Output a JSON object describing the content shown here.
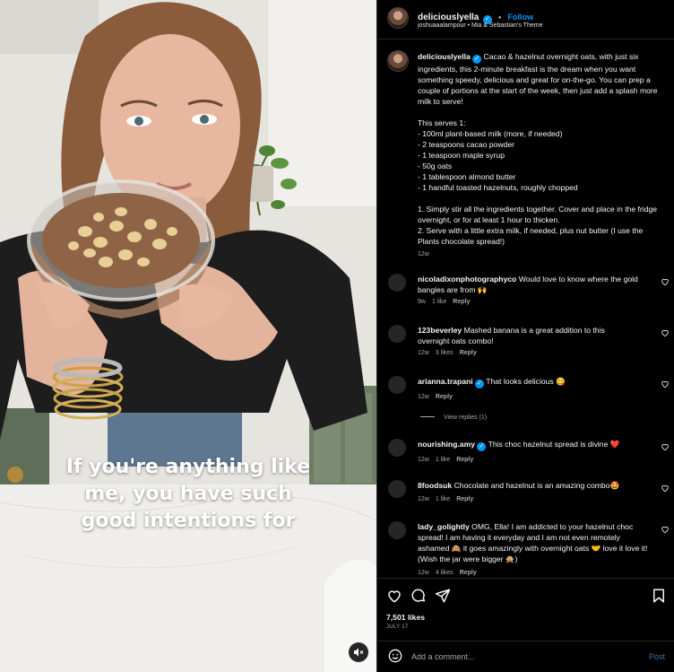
{
  "post": {
    "username": "deliciouslyella",
    "verified_mark": "✓",
    "separator": "•",
    "follow_label": "Follow",
    "audio_line": "joshuaaalampour • Mia & Sebastian's Theme",
    "caption": "Cacao & hazelnut overnight oats, with just six ingredients, this 2-minute breakfast is the dream when you want something speedy, delicious and great for on-the-go. You can prep a couple of portions at the start of the week, then just add a splash more milk to serve!\n\nThis serves 1:\n- 100ml plant-based milk (more, if needed)\n- 2 teaspoons cacao powder\n- 1 teaspoon maple syrup\n- 50g oats\n- 1 tablespoon almond butter\n- 1 handful toasted hazelnuts, roughly chopped\n\n1. Simply stir all the ingredients together. Cover and place in the fridge overnight, or for at least 1 hour to thicken.\n2. Serve with a little extra milk, if needed, plus nut butter (I use the Plants chocolate spread!)",
    "caption_age": "12w"
  },
  "video": {
    "overlay_line1": "If you're anything like",
    "overlay_line2": "me, you have such",
    "overlay_line3": "good intentions for",
    "mute_icon": "speaker-muted-icon"
  },
  "comments": [
    {
      "username": "nicoladixonphotographyco",
      "verified": false,
      "text": "Would love to know where the gold bangles are from 🙌",
      "age": "9w",
      "likes": "1 like",
      "reply": "Reply"
    },
    {
      "username": "123beverley",
      "verified": false,
      "text": "Mashed banana is a great addition to this overnight oats combo!",
      "age": "12w",
      "likes": "3 likes",
      "reply": "Reply"
    },
    {
      "username": "arianna.trapani",
      "verified": true,
      "text": "That looks delicious 😋",
      "age": "12w",
      "likes": "",
      "reply": "Reply",
      "view_replies": "View replies (1)"
    },
    {
      "username": "nourishing.amy",
      "verified": true,
      "text": "This choc hazelnut spread is divine ❤️",
      "age": "12w",
      "likes": "1 like",
      "reply": "Reply"
    },
    {
      "username": "8foodsuk",
      "verified": false,
      "text": "Chocolate and hazelnut is an amazing combo🤩",
      "age": "12w",
      "likes": "1 like",
      "reply": "Reply"
    },
    {
      "username": "lady_golightly",
      "verified": false,
      "text": "OMG, Ella! I am addicted to your hazelnut choc spread! I am having it everyday and I am not even remotely ashamed 🙈 it goes amazingly with overnight oats 🤝 love it love it! (Wish the jar were bigger 🙊)",
      "age": "12w",
      "likes": "4 likes",
      "reply": "Reply"
    }
  ],
  "actions": {
    "like_icon": "heart-icon",
    "comment_icon": "comment-bubble-icon",
    "share_icon": "paper-plane-icon",
    "save_icon": "bookmark-icon",
    "likes_count": "7,501 likes",
    "date": "JULY 17"
  },
  "composer": {
    "emoji_icon": "smiley-icon",
    "placeholder": "Add a comment...",
    "post_label": "Post"
  },
  "colors": {
    "background": "#000000",
    "text": "#f5f5f5",
    "muted": "#a8a8a8",
    "link_blue": "#0095f6",
    "post_dim": "#3f78a8",
    "divider": "#262626"
  }
}
